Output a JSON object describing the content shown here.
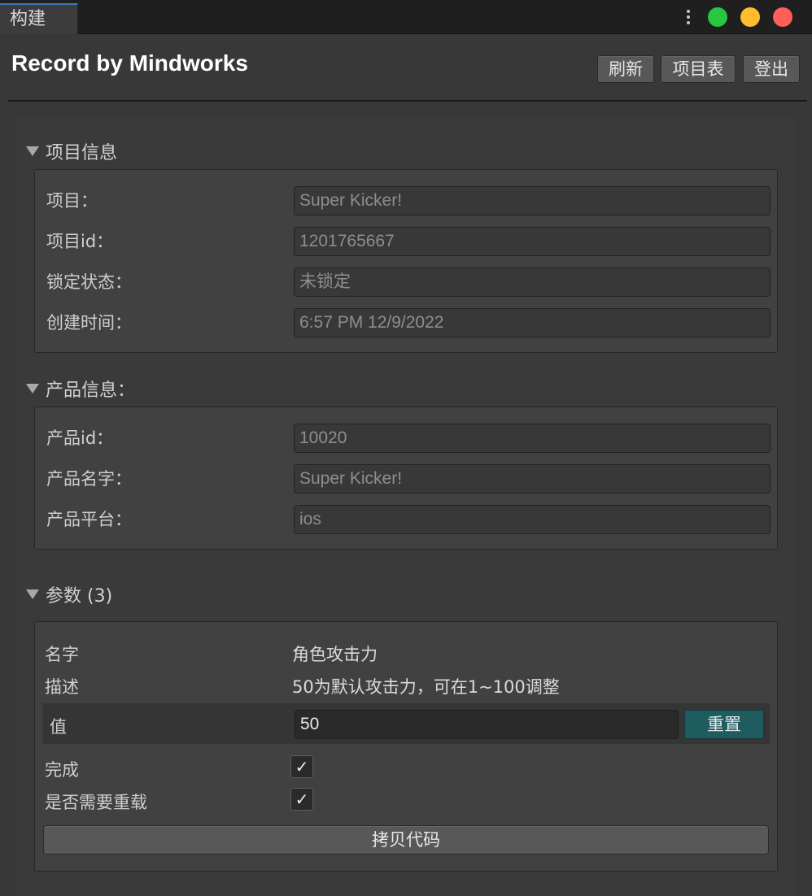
{
  "tab": {
    "label": "构建"
  },
  "window_controls": {
    "green": "#27c840",
    "yellow": "#febc2e",
    "red": "#ff5f57"
  },
  "header": {
    "title": "Record by Mindworks",
    "buttons": {
      "refresh": "刷新",
      "project_list": "项目表",
      "logout": "登出"
    }
  },
  "project_info": {
    "heading": "项目信息",
    "rows": [
      {
        "label": "项目：",
        "value": "Super Kicker!"
      },
      {
        "label": "项目id：",
        "value": "1201765667"
      },
      {
        "label": "锁定状态：",
        "value": "未锁定"
      },
      {
        "label": "创建时间：",
        "value": "6:57 PM 12/9/2022"
      }
    ]
  },
  "product_info": {
    "heading": "产品信息：",
    "rows": [
      {
        "label": "产品id：",
        "value": "10020"
      },
      {
        "label": "产品名字：",
        "value": "Super Kicker!"
      },
      {
        "label": "产品平台：",
        "value": "ios"
      }
    ]
  },
  "params": {
    "heading": "参数 (3)",
    "name_label": "名字",
    "name_value": "角色攻击力",
    "desc_label": "描述",
    "desc_value": "50为默认攻击力，可在1~100调整",
    "value_label": "值",
    "value": "50",
    "reset_label": "重置",
    "done_label": "完成",
    "done_checked": true,
    "reload_label": "是否需要重载",
    "reload_checked": true,
    "check_mark": "✓",
    "copy_label": "拷贝代码"
  }
}
